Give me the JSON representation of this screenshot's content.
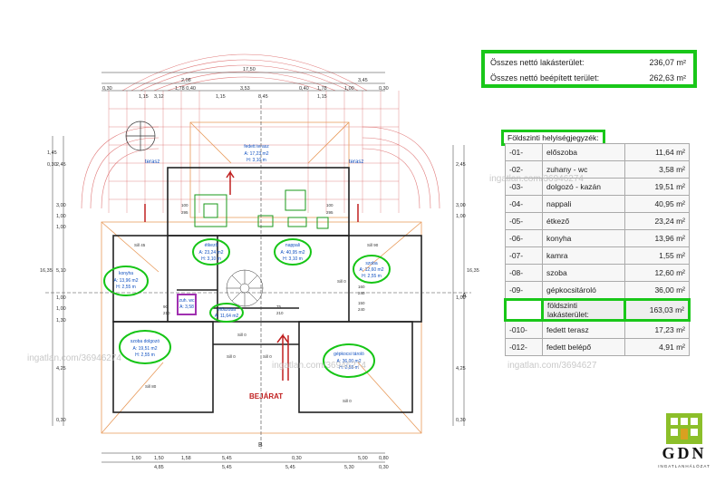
{
  "summary": {
    "row1": {
      "label": "Összes nettó lakásterület:",
      "value": "236,07 m²"
    },
    "row2": {
      "label": "Összes nettó beépített terület:",
      "value": "262,63 m²"
    }
  },
  "legend": {
    "title": "Földszinti helyiségjegyzék:",
    "rows": [
      {
        "code": "-01-",
        "name": "előszoba",
        "area": "11,64 m²"
      },
      {
        "code": "-02-",
        "name": "zuhany - wc",
        "area": "3,58 m²"
      },
      {
        "code": "-03-",
        "name": "dolgozó - kazán",
        "area": "19,51 m²"
      },
      {
        "code": "-04-",
        "name": "nappali",
        "area": "40,95 m²"
      },
      {
        "code": "-05-",
        "name": "étkező",
        "area": "23,24 m²"
      },
      {
        "code": "-06-",
        "name": "konyha",
        "area": "13,96 m²"
      },
      {
        "code": "-07-",
        "name": "kamra",
        "area": "1,55 m²"
      },
      {
        "code": "-08-",
        "name": "szoba",
        "area": "12,60 m²"
      },
      {
        "code": "-09-",
        "name": "gépkocsitároló",
        "area": "36,00 m²"
      }
    ],
    "total": {
      "label": "földszinti lakásterület:",
      "area": "163,03 m²"
    },
    "extra": [
      {
        "code": "-010-",
        "name": "fedett terasz",
        "area": "17,23 m²"
      },
      {
        "code": "-012-",
        "name": "fedett belépő",
        "area": "4,91 m²"
      }
    ]
  },
  "plan": {
    "dims_top": [
      "17,50",
      "2,08",
      "3,45",
      "0,30",
      "1,78 0,40",
      "3,53",
      "0,40",
      "1,78",
      "1,00",
      "0,30",
      "1,15",
      "3,12",
      "1,15",
      "8,45",
      "1,15"
    ],
    "dims_bottom": [
      "1,90",
      "1,50",
      "1,58",
      "5,45",
      "0,30",
      "5,00",
      "0,80",
      "4,85",
      "5,45",
      "5,45",
      "5,30",
      "0,30"
    ],
    "dims_left": [
      "1,45",
      "0,30",
      "2,45",
      "3,00",
      "1,00",
      "1,00",
      "16,35",
      "5,10",
      "1,00",
      "1,00",
      "1,30",
      "4,25",
      "0,30"
    ],
    "dims_right": [
      "2,45",
      "3,00",
      "1,00",
      "16,35",
      "1,00",
      "4,25",
      "0,30"
    ],
    "rooms": [
      {
        "name": "fedett terasz",
        "sub": "A: 17,23 m2",
        "h": "H: 3,10 m"
      },
      {
        "name": "étkező",
        "sub": "A: 23,24 m2",
        "h": "H: 3,10 m"
      },
      {
        "name": "nappali",
        "sub": "A: 40,95 m2",
        "h": "H: 3,10 m"
      },
      {
        "name": "konyha",
        "sub": "A: 13,96 m2",
        "h": "H: 2,55 m"
      },
      {
        "name": "szoba",
        "sub": "A: 12,60 m2",
        "h": "H: 2,55 m"
      },
      {
        "name": "szoba dolgozó",
        "sub": "A: 19,51 m2",
        "h": "H: 2,55 m"
      },
      {
        "name": "gépkocsi tároló",
        "sub": "A: 36,00 m2",
        "h": "H: 2,55 m"
      },
      {
        "name": "előszoba",
        "sub": "A: 11,64 m2",
        "h": "H: 2,55 m"
      },
      {
        "name": "zuh. wc",
        "sub": "A: 3,58",
        "h": ""
      }
    ],
    "terasz_left": "terasz",
    "terasz_right": "terasz",
    "sill_labels": [
      "Sill 45",
      "Sill 90",
      "Sill 80",
      "Sill 0",
      "Sill 0",
      "Sill 0",
      "Sill 0",
      "Sill 0"
    ],
    "door_nums": [
      "100",
      "295",
      "100",
      "295",
      "160",
      "240",
      "150",
      "240",
      "90",
      "210",
      "75",
      "210"
    ],
    "entrance": "BEJÁRAT",
    "section_a": "A",
    "section_b": "B"
  },
  "watermarks": [
    "ingatlan.com/36946274",
    "ingatlan.com/36946274",
    "ingatlan.com/36946274",
    "ingatlan.com/3694627"
  ],
  "logo": {
    "text": "GDN",
    "sub": "INGATLANHÁLÓZAT"
  }
}
